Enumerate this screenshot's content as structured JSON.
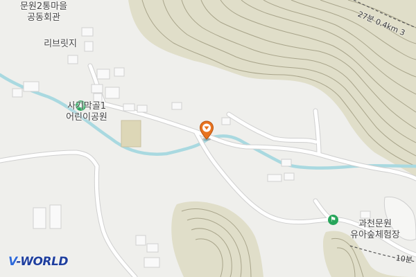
{
  "map": {
    "colors": {
      "background": "#efefec",
      "hill": "#e0dec9",
      "contour": "#a8a48a",
      "stream": "#a9d9e0",
      "road": "#ffffff",
      "road_edge": "#cfcfcf",
      "building": "#f9f9f9",
      "park": "#ddd7b7",
      "marker": "#e8731f",
      "poi_green": "#27a55a"
    },
    "labels": {
      "community_hall": "문원2통마을\n공동회관",
      "place_ribeuritji": "리브릿지",
      "park_name": "사기막골1\n어린이공원",
      "forest_center": "과천문원\n유아숲체험장"
    },
    "road_labels": {
      "route_27": "27분 0.4km 3",
      "route_10": "10분"
    },
    "icons": {
      "park_icon": "playground-icon",
      "forest_icon": "forest-flag-icon",
      "location_marker": "map-pin-icon"
    },
    "brand": {
      "logo_v": "V",
      "logo_rest": "-WORLD"
    }
  }
}
